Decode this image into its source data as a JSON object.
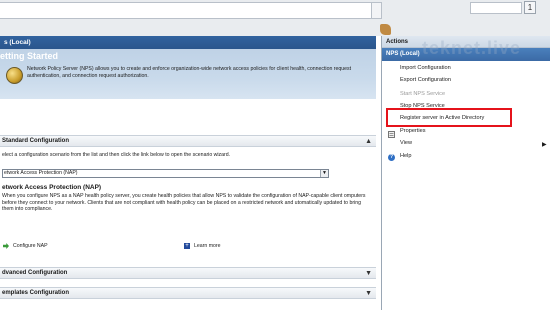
{
  "console": {
    "corner_button": "1"
  },
  "left": {
    "pane_title": "s (Local)",
    "banner_title": "etting Started",
    "banner_desc": "Network Policy Server (NPS) allows you to create and enforce organization-wide network access policies for client health, connection request authentication, and connection request authorization.",
    "standard": {
      "heading": "Standard Configuration",
      "instruction": "elect a configuration scenario from the list and then click the link below to open the scenario wizard.",
      "selected_scenario": "etwork Access Protection (NAP)",
      "nap_heading": "etwork Access Protection (NAP)",
      "nap_desc": "When you configure NPS as a NAP health policy server, you create health policies that allow NPS to validate the configuration of NAP-capable client omputers before they connect to your network. Clients that are not compliant with health policy can be placed on a restricted network and utomatically updated to bring them into compliance.",
      "configure_link": "Configure NAP",
      "learn_more_link": "Learn more"
    },
    "advanced_heading": "dvanced Configuration",
    "templates_heading": "emplates Configuration"
  },
  "actions": {
    "title": "Actions",
    "group": "NPS (Local)",
    "watermark": "teknet.live",
    "items": [
      {
        "label": "Import Configuration",
        "enabled": true
      },
      {
        "label": "Export Configuration",
        "enabled": true
      },
      {
        "label": "Start NPS Service",
        "enabled": false
      },
      {
        "label": "Stop NPS Service",
        "enabled": true
      },
      {
        "label": "Register server in Active Directory",
        "enabled": true
      },
      {
        "label": "Properties",
        "enabled": true
      },
      {
        "label": "View",
        "enabled": true
      },
      {
        "label": "Help",
        "enabled": true
      }
    ],
    "highlight_color": "#e5131b"
  }
}
